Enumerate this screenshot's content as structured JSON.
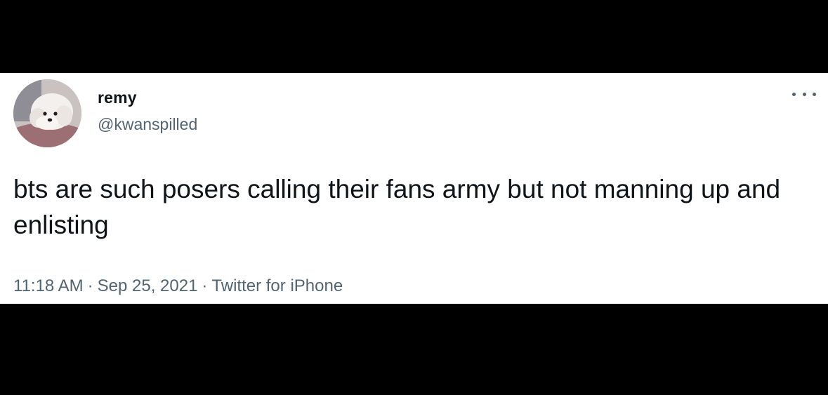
{
  "tweet": {
    "author": {
      "display_name": "remy",
      "handle": "@kwanspilled",
      "avatar_icon": "puppy-avatar-icon"
    },
    "more_icon": "more-options-icon",
    "text": "bts are such posers calling their fans army but not manning up and enlisting",
    "time": "11:18 AM",
    "separator": "·",
    "date": "Sep 25, 2021",
    "source": "Twitter for iPhone"
  },
  "colors": {
    "background": "#000000",
    "card": "#ffffff",
    "text_primary": "#0f1419",
    "text_secondary": "#536471"
  }
}
